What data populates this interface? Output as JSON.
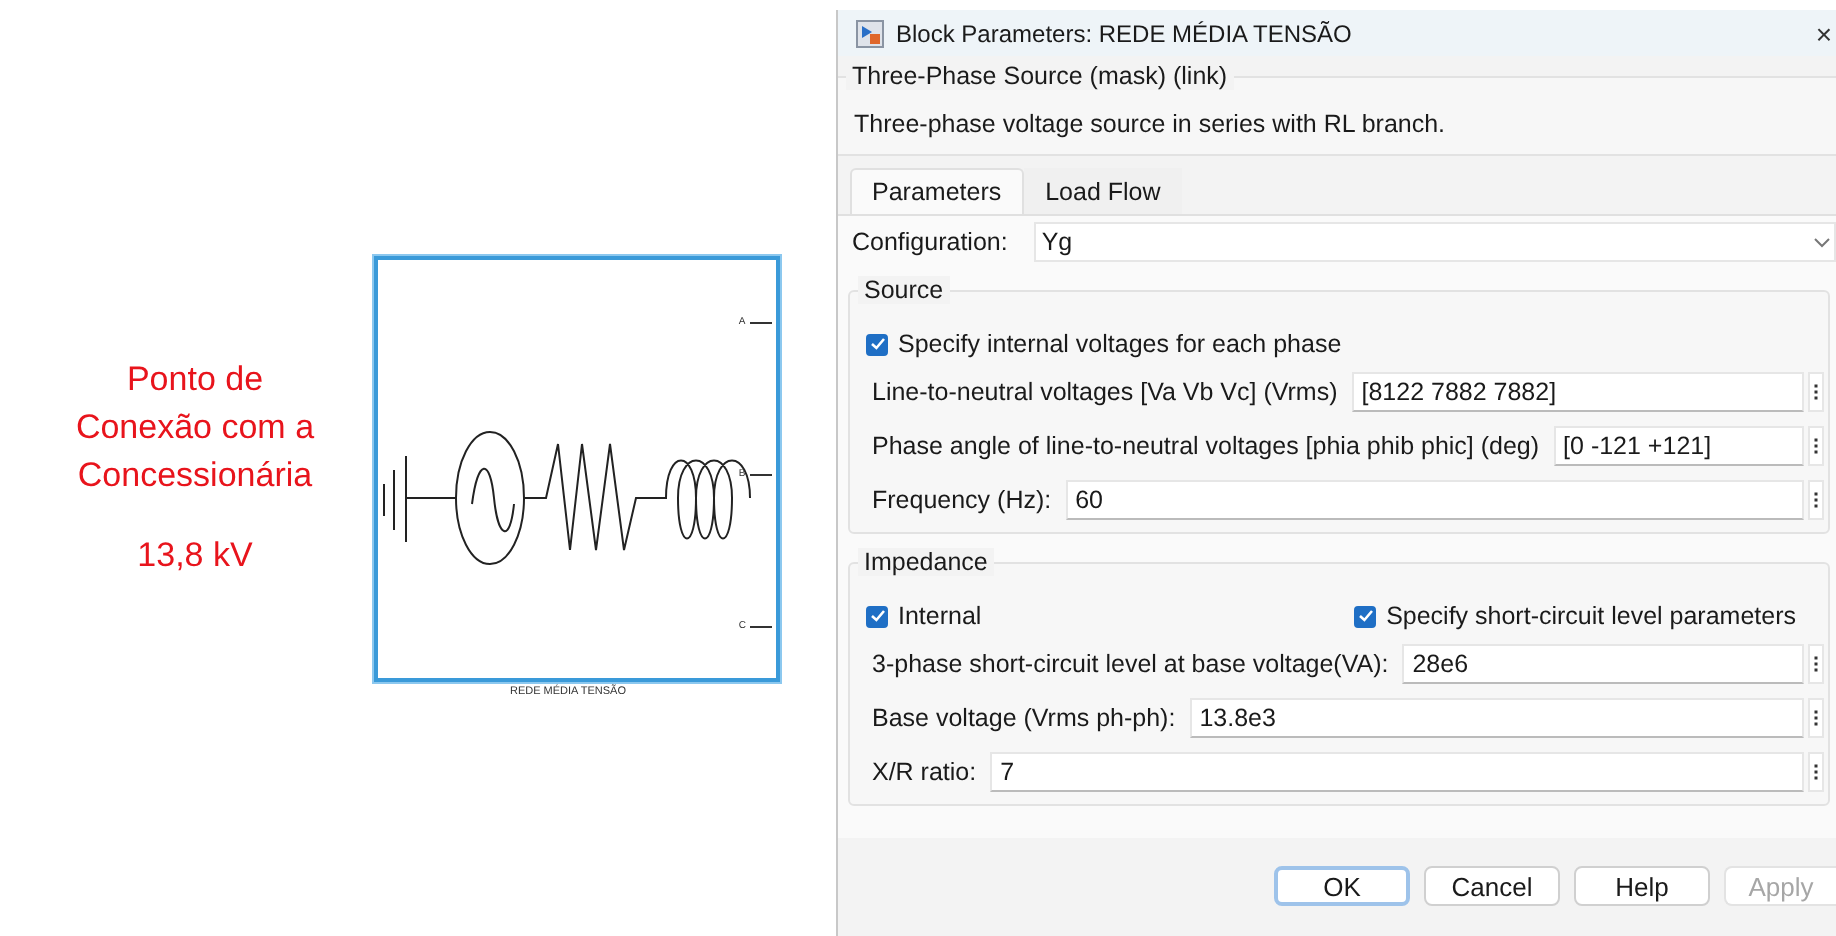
{
  "canvas": {
    "label_lines": [
      "Ponto de",
      "Conexão com a",
      "Concessionária"
    ],
    "voltage": "13,8 kV",
    "block": {
      "selected": true,
      "ports": [
        "A",
        "B",
        "C"
      ],
      "name": "REDE MÉDIA TENSÃO"
    }
  },
  "dialog": {
    "title": "Block Parameters: REDE MÉDIA TENSÃO",
    "close": "×",
    "mask_title": "Three-Phase Source (mask) (link)",
    "description": "Three-phase voltage source in series with RL branch.",
    "tabs": [
      {
        "label": "Parameters",
        "selected": true
      },
      {
        "label": "Load Flow",
        "selected": false
      }
    ],
    "configuration": {
      "label": "Configuration:",
      "value": "Yg"
    },
    "groups": [
      {
        "legend": "Source",
        "rows": [
          {
            "kind": "checkbox",
            "items": [
              {
                "label": "Specify internal voltages for each phase",
                "checked": true
              }
            ]
          },
          {
            "kind": "field",
            "label": "Line-to-neutral voltages [Va Vb Vc] (Vrms)",
            "value": "[8122 7882 7882]"
          },
          {
            "kind": "field",
            "label": "Phase angle of line-to-neutral voltages [phia phib phic] (deg)",
            "value": "[0 -121 +121]"
          },
          {
            "kind": "field",
            "label": "Frequency (Hz):",
            "value": "60"
          }
        ]
      },
      {
        "legend": "Impedance",
        "rows": [
          {
            "kind": "checkbox",
            "items": [
              {
                "label": "Internal",
                "checked": true
              },
              {
                "label": "Specify short-circuit level parameters",
                "checked": true
              }
            ]
          },
          {
            "kind": "field",
            "label": "3-phase short-circuit level at base voltage(VA):",
            "value": "28e6"
          },
          {
            "kind": "field",
            "label": "Base voltage (Vrms ph-ph):",
            "value": "13.8e3"
          },
          {
            "kind": "field",
            "label": "X/R ratio:",
            "value": "7"
          }
        ]
      }
    ],
    "buttons": [
      {
        "label": "OK",
        "disabled": false,
        "default": true
      },
      {
        "label": "Cancel",
        "disabled": false,
        "default": false
      },
      {
        "label": "Help",
        "disabled": false,
        "default": false
      },
      {
        "label": "Apply",
        "disabled": true,
        "default": false
      }
    ]
  }
}
